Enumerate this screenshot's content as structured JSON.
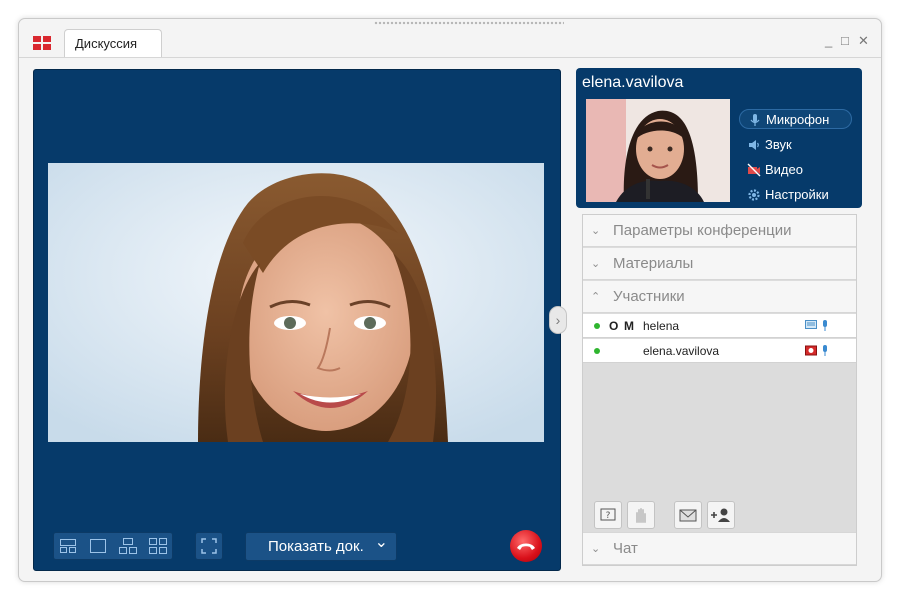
{
  "window": {
    "tab_label": "Дискуссия",
    "controls": {
      "minimize": "_",
      "maximize": "□",
      "close": "✕"
    }
  },
  "video_toolbar": {
    "show_doc_label": "Показать док.",
    "show_doc_arrow": "⌄"
  },
  "self_view": {
    "user_name": "elena.vavilova",
    "controls": [
      {
        "label": "Микрофон",
        "icon": "microphone-icon",
        "active": true
      },
      {
        "label": "Звук",
        "icon": "speaker-icon",
        "active": false
      },
      {
        "label": "Видео",
        "icon": "video-off-icon",
        "active": false
      },
      {
        "label": "Настройки",
        "icon": "gear-icon",
        "active": false
      }
    ]
  },
  "sidebar": {
    "sections": [
      {
        "label": "Параметры конференции",
        "expanded": false
      },
      {
        "label": "Материалы",
        "expanded": false
      },
      {
        "label": "Участники",
        "expanded": true
      },
      {
        "label": "Чат",
        "expanded": false
      }
    ],
    "participants": [
      {
        "name": "helena",
        "flag_o": "O",
        "flag_m": "M",
        "online": true,
        "video_icon": "screen-icon",
        "mic_icon": "microphone-icon"
      },
      {
        "name": "elena.vavilova",
        "flag_o": "",
        "flag_m": "",
        "online": true,
        "video_icon": "camera-icon",
        "mic_icon": "microphone-icon"
      }
    ]
  },
  "colors": {
    "panel_blue": "#063a6a",
    "accent_red": "#d9282f",
    "online_green": "#2fb52f"
  }
}
